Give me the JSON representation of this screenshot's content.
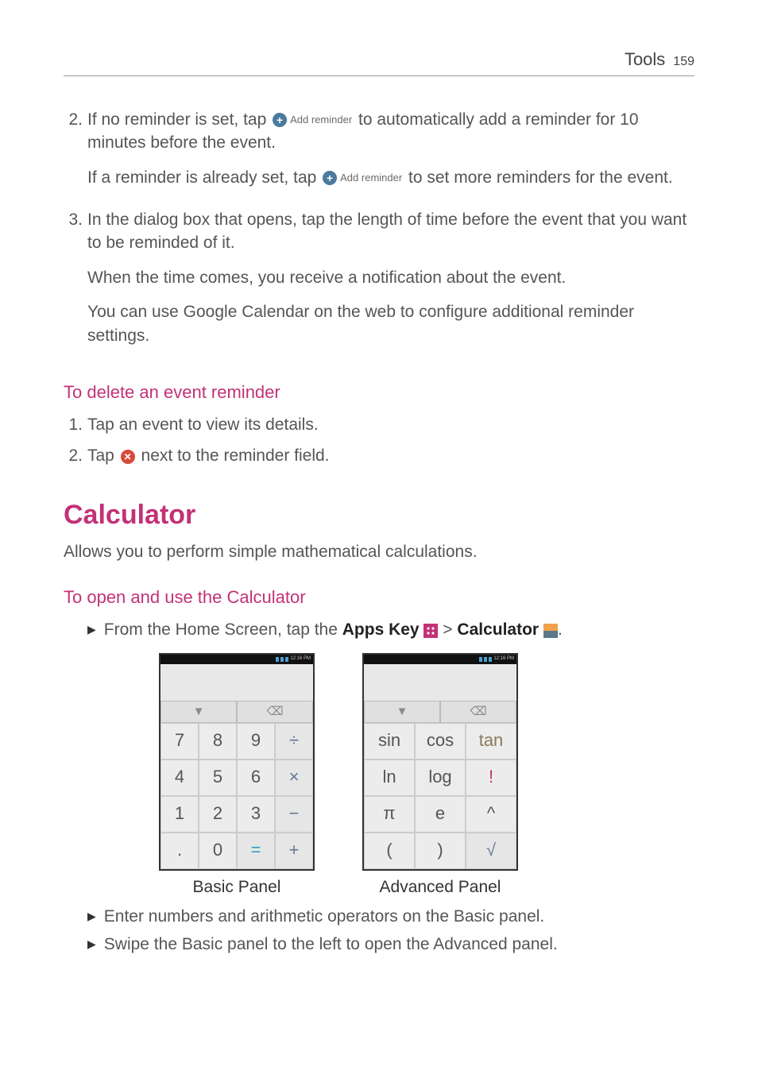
{
  "header": {
    "section": "Tools",
    "page": "159"
  },
  "steps_top": [
    {
      "num": "2.",
      "p1a": "If no reminder is set, tap ",
      "p1b": " to automatically add a reminder for 10 minutes before the event.",
      "p2a": "If a reminder is already set, tap ",
      "p2b": " to set more reminders for the event.",
      "btn_label": "Add reminder"
    },
    {
      "num": "3.",
      "p1": "In the dialog box that opens, tap the length of time before the event that you want to be reminded of it.",
      "p2": "When the time comes, you receive a notification about the event.",
      "p3": "You can use Google Calendar on the web to configure additional reminder settings."
    }
  ],
  "delete_heading": "To delete an event reminder",
  "delete_steps": [
    {
      "num": "1.",
      "text": "Tap an event to view its details."
    },
    {
      "num": "2.",
      "pre": "Tap ",
      "post": " next to the reminder field."
    }
  ],
  "calc_heading": "Calculator",
  "calc_intro": "Allows you to perform simple mathematical calculations.",
  "open_heading": "To open and use the Calculator",
  "open_line": {
    "pre": "From the Home Screen, tap the ",
    "apps": "Apps Key",
    "mid": " > ",
    "calc": "Calculator",
    "post": "."
  },
  "basic_panel": {
    "label": "Basic Panel",
    "dropdown": "▼",
    "backspace": "⌫",
    "keys": [
      "7",
      "8",
      "9",
      "÷",
      "4",
      "5",
      "6",
      "×",
      "1",
      "2",
      "3",
      "−",
      ".",
      "0",
      "=",
      "+"
    ]
  },
  "advanced_panel": {
    "label": "Advanced Panel",
    "dropdown": "▼",
    "backspace": "⌫",
    "keys": [
      "sin",
      "cos",
      "tan",
      "ln",
      "log",
      "!",
      "π",
      "e",
      "^",
      "(",
      ")",
      "√"
    ]
  },
  "bottom_bullets": [
    "Enter numbers and arithmetic operators on the Basic panel.",
    "Swipe the Basic panel to the left to open the Advanced panel."
  ]
}
